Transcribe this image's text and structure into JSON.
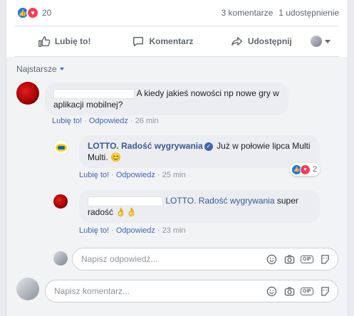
{
  "stats": {
    "reaction_count": "20",
    "comments": "3 komentarze",
    "shares": "1 udostępnienie"
  },
  "actions": {
    "like": "Lubię to!",
    "comment": "Komentarz",
    "share": "Udostępnij"
  },
  "sort": {
    "label": "Najstarsze"
  },
  "comment1": {
    "text": "A kiedy jakieś nowości np nowe gry w aplikacji mobilnej?",
    "like_link": "Lubię to!",
    "reply_link": "Odpowiedz",
    "time": "26 min"
  },
  "reply1": {
    "author": "LOTTO. Radość wygrywania",
    "text": "Już w połowie lipca Multi Multi. 😊",
    "like_link": "Lubię to!",
    "reply_link": "Odpowiedz",
    "time": "25 min",
    "reactions": "2"
  },
  "reply2": {
    "mention": "LOTTO. Radość wygrywania",
    "text": "super radość 👌👌",
    "like_link": "Lubię to!",
    "reply_link": "Odpowiedz",
    "time": "23 min"
  },
  "reply_input": {
    "placeholder": "Napisz odpowiedź..."
  },
  "comment_input": {
    "placeholder": "Napisz komentarz..."
  },
  "colors": {
    "link": "#385898",
    "like_blue": "#1877f2",
    "love_red": "#f33e58"
  }
}
